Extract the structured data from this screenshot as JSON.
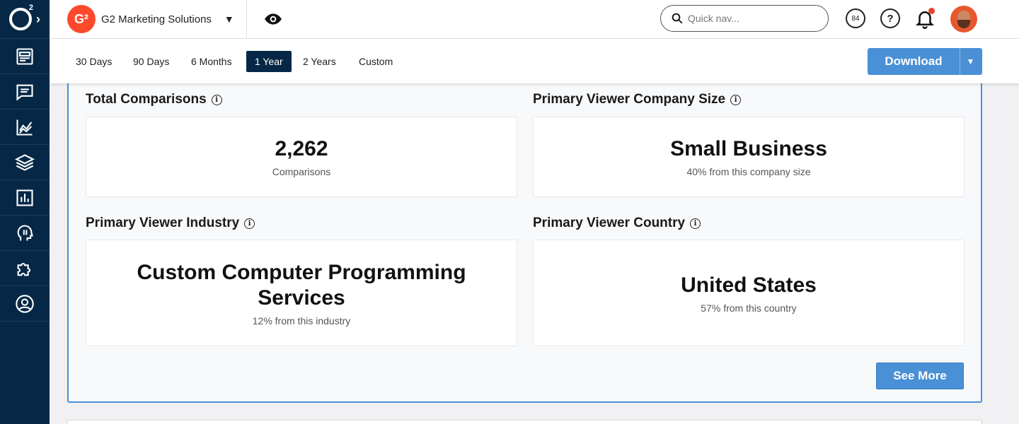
{
  "brand": {
    "name": "G2 Marketing Solutions",
    "badge": "G²",
    "color": "#ff492c"
  },
  "header": {
    "search_placeholder": "Quick nav...",
    "score_badge": "84",
    "help_symbol": "?"
  },
  "nav": {
    "icons": [
      "dashboard-icon",
      "reviews-icon",
      "analytics-icon",
      "layers-icon",
      "reports-icon",
      "insights-icon",
      "integrations-icon",
      "profile-icon"
    ]
  },
  "filters": {
    "ranges": [
      "30 Days",
      "90 Days",
      "6 Months",
      "1 Year",
      "2 Years",
      "Custom"
    ],
    "selected": "1 Year",
    "download_label": "Download"
  },
  "cards": {
    "total_comparisons": {
      "title": "Total Comparisons",
      "value": "2,262",
      "sub": "Comparisons"
    },
    "company_size": {
      "title": "Primary Viewer Company Size",
      "value": "Small Business",
      "sub": "40% from this company size"
    },
    "industry": {
      "title": "Primary Viewer Industry",
      "value": "Custom Computer Programming Services",
      "sub": "12% from this industry"
    },
    "country": {
      "title": "Primary Viewer Country",
      "value": "United States",
      "sub": "57% from this country"
    }
  },
  "see_more_label": "See More",
  "colors": {
    "nav_bg": "#062846",
    "accent": "#4a90d6",
    "active_range": "#062846"
  }
}
